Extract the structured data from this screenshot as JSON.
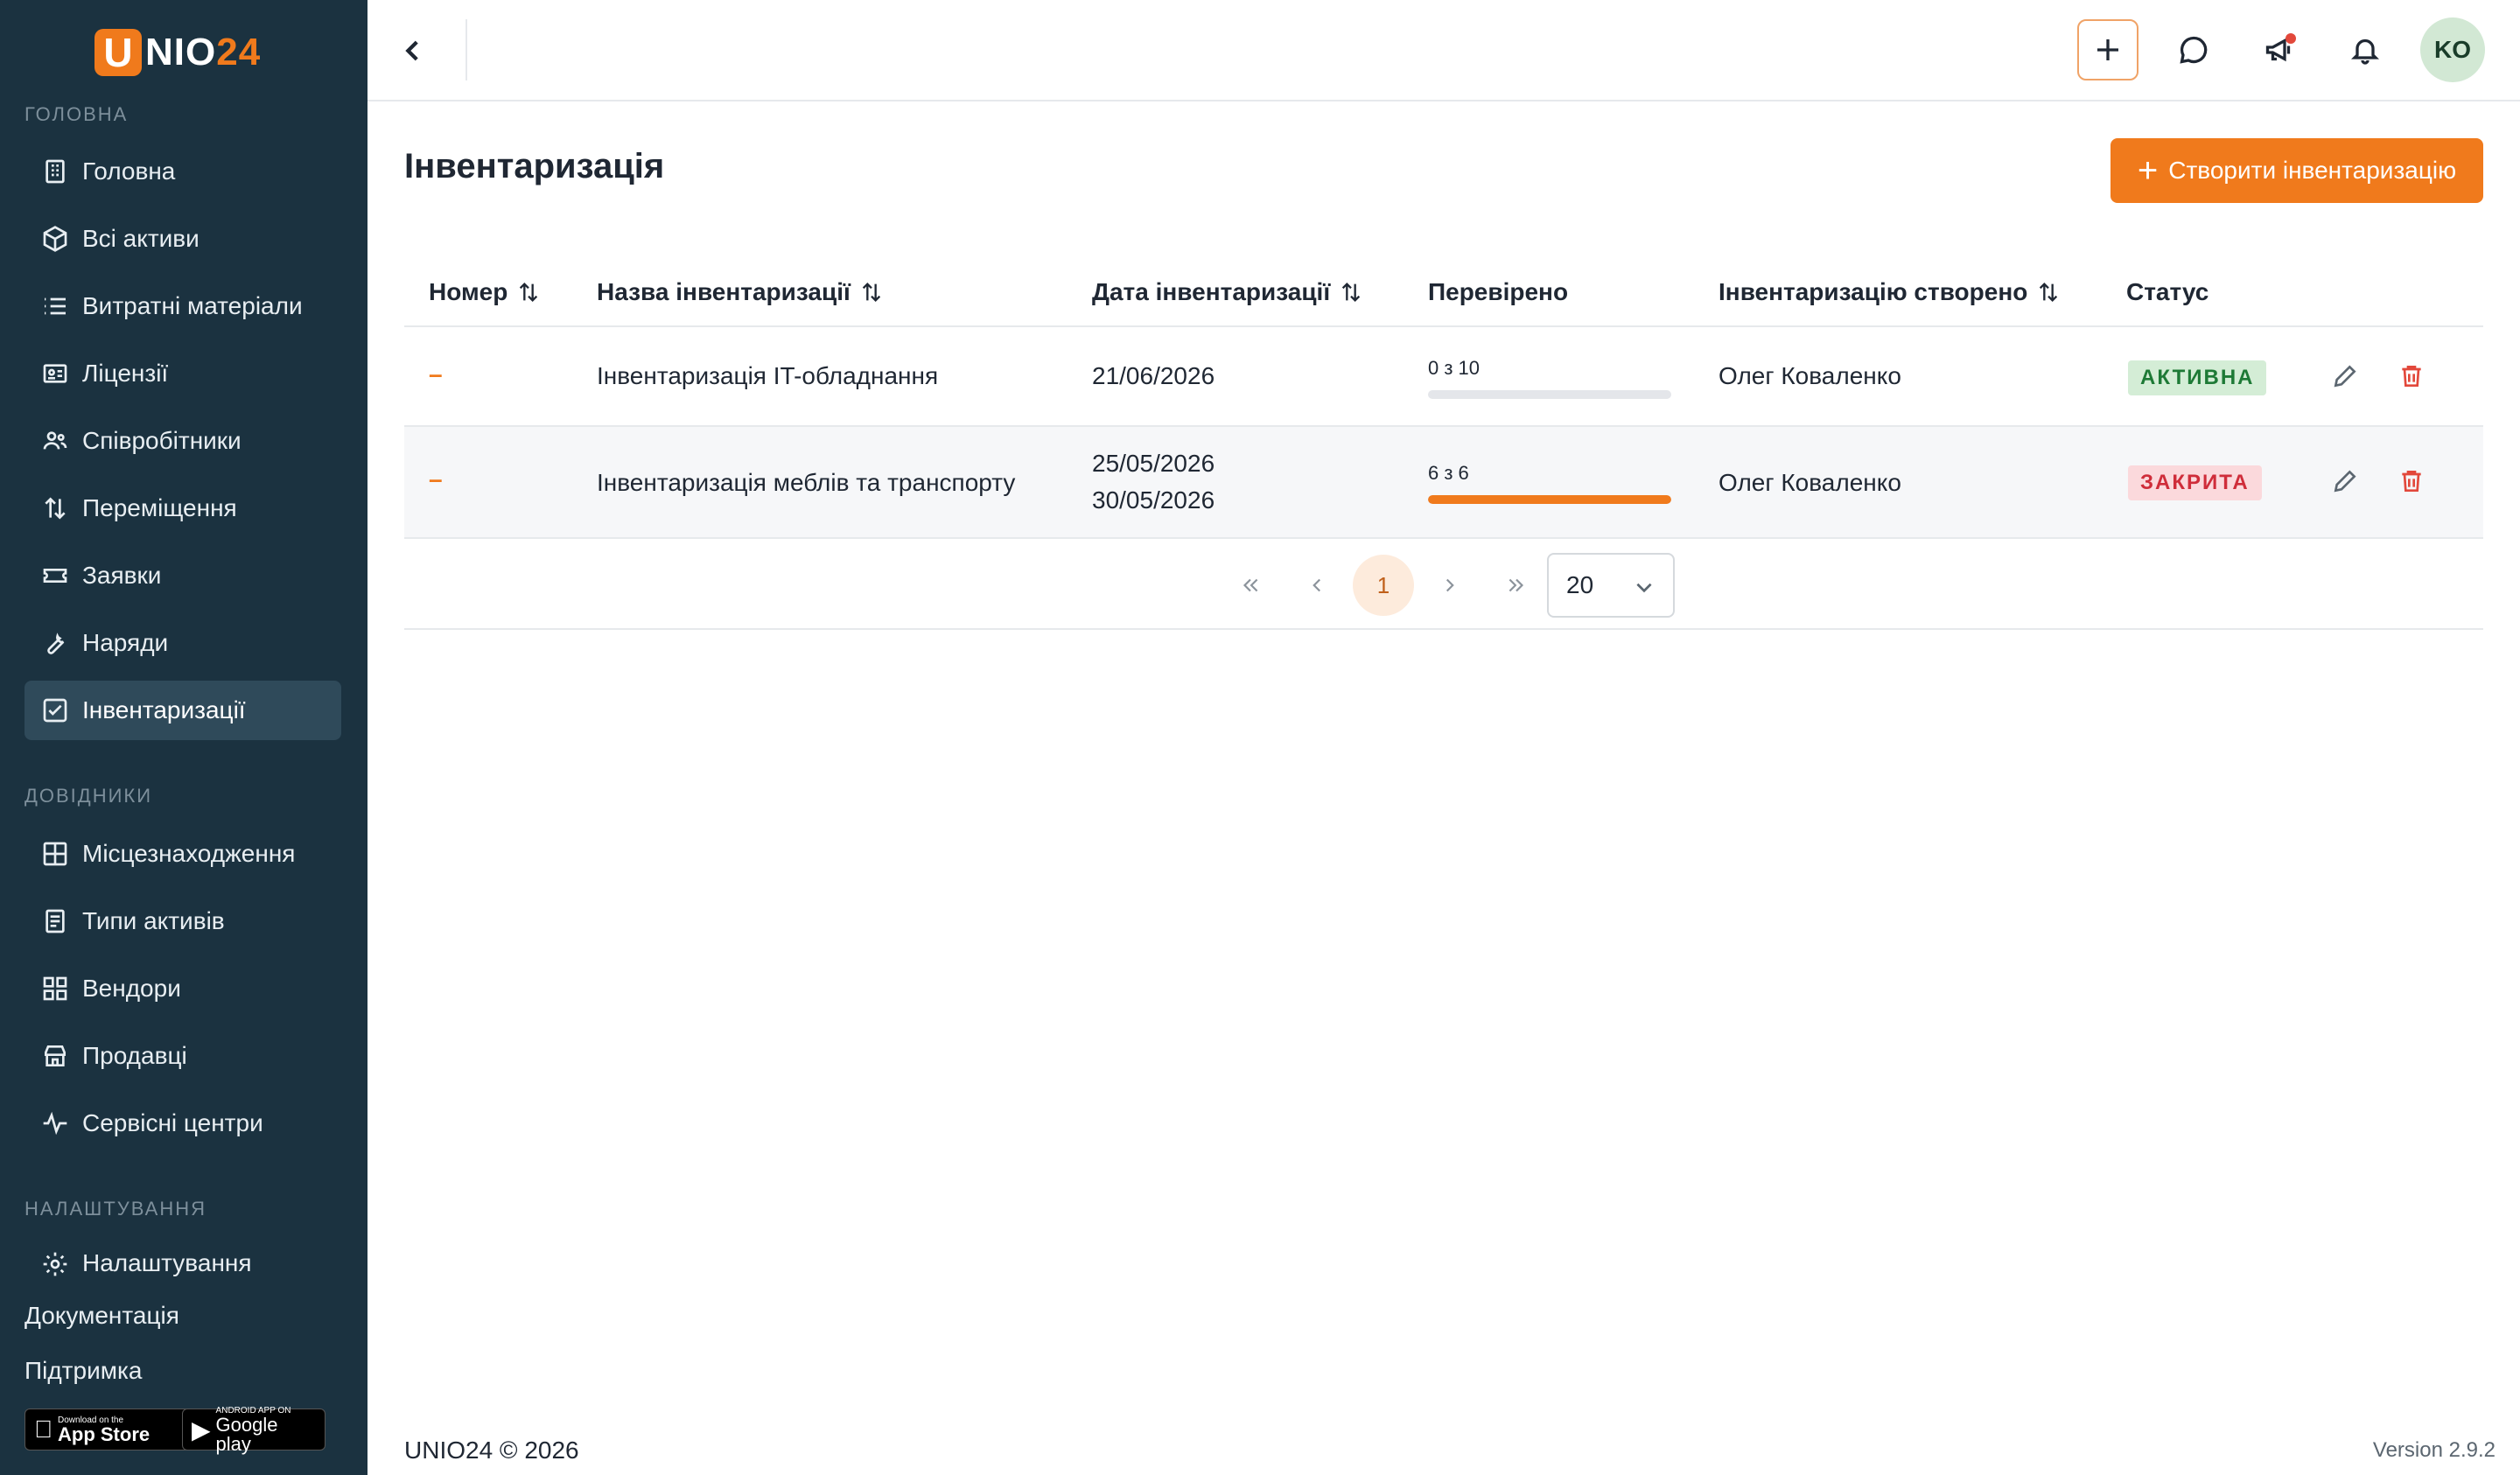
{
  "brand": {
    "logo_letter": "U",
    "logo_text": "NIO",
    "logo_num": "24"
  },
  "sidebar": {
    "sections": [
      "ГОЛОВНА",
      "ДОВІДНИКИ",
      "НАЛАШТУВАННЯ"
    ],
    "main_items": [
      {
        "label": "Головна",
        "icon": "building-icon"
      },
      {
        "label": "Всі активи",
        "icon": "cube-icon"
      },
      {
        "label": "Витратні матеріали",
        "icon": "list-icon"
      },
      {
        "label": "Ліцензії",
        "icon": "id-card-icon"
      },
      {
        "label": "Співробітники",
        "icon": "users-icon"
      },
      {
        "label": "Переміщення",
        "icon": "arrows-updown-icon"
      },
      {
        "label": "Заявки",
        "icon": "ticket-icon"
      },
      {
        "label": "Наряди",
        "icon": "wrench-icon"
      },
      {
        "label": "Інвентаризації",
        "icon": "checkbox-icon"
      }
    ],
    "ref_items": [
      {
        "label": "Місцезнаходження",
        "icon": "grid-icon"
      },
      {
        "label": "Типи активів",
        "icon": "document-icon"
      },
      {
        "label": "Вендори",
        "icon": "blocks-icon"
      },
      {
        "label": "Продавці",
        "icon": "store-icon"
      },
      {
        "label": "Сервісні центри",
        "icon": "activity-icon"
      }
    ],
    "settings_item": {
      "label": "Налаштування",
      "icon": "gear-icon"
    },
    "docs_link": "Документація",
    "support_link": "Підтримка",
    "app_store": {
      "small": "Download on the",
      "big": "App Store"
    },
    "google_play": {
      "small": "ANDROID APP ON",
      "big": "Google play"
    }
  },
  "topbar": {
    "avatar_initials": "KO"
  },
  "page": {
    "title": "Інвентаризація",
    "create_button": "Створити інвентаризацію"
  },
  "table": {
    "headers": [
      "Номер",
      "Назва інвентаризації",
      "Дата інвентаризації",
      "Перевірено",
      "Інвентаризацію створено",
      "Статус"
    ],
    "rows": [
      {
        "number": "–",
        "name": "Інвентаризація IT-обладнання",
        "date_start": "21/06/2026",
        "date_end": "",
        "checked": "0 з 10",
        "progress": 0.0,
        "creator": "Олег Коваленко",
        "status": "АКТИВНА",
        "status_kind": "active"
      },
      {
        "number": "–",
        "name": "Інвентаризація меблів та транспорту",
        "date_start": "25/05/2026",
        "date_end": "30/05/2026",
        "checked": "6 з 6",
        "progress": 1.0,
        "creator": "Олег Коваленко",
        "status": "ЗАКРИТА",
        "status_kind": "closed"
      }
    ]
  },
  "pagination": {
    "current_page": "1",
    "page_size": "20"
  },
  "footer": {
    "copyright": "UNIO24 © 2026",
    "version": "Version 2.9.2"
  },
  "colors": {
    "accent": "#f07a1c",
    "sidebar_bg": "#1b3240",
    "active_badge": "#d4edd6",
    "closed_badge": "#fbd9dc"
  }
}
